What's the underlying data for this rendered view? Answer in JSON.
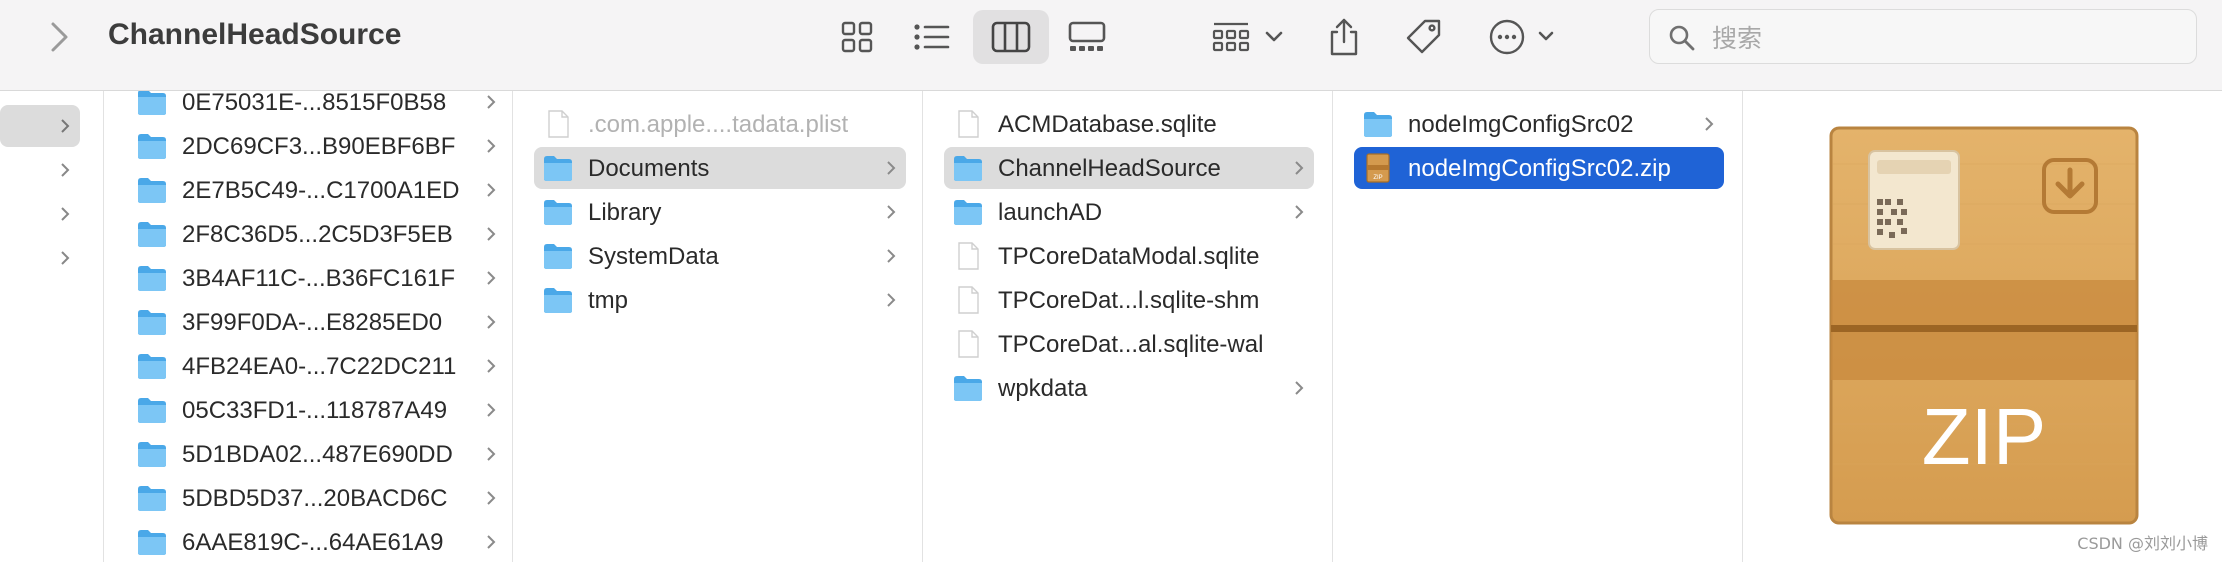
{
  "window": {
    "title": "ChannelHeadSource"
  },
  "search": {
    "placeholder": "搜索"
  },
  "toolbar": {
    "icons": [
      "chevron-right-icon",
      "icon-view-icon",
      "list-view-icon",
      "column-view-icon",
      "gallery-view-icon",
      "group-icon",
      "share-icon",
      "tag-icon",
      "more-icon",
      "search-icon"
    ],
    "active_view": "column"
  },
  "colors": {
    "selection_blue": "#1f63d6",
    "selection_gray": "#dcdcdc",
    "folder_blue": "#5eb8ee"
  },
  "column1": {
    "items": [
      {
        "label": "0E75031E-...8515F0B58"
      },
      {
        "label": "2DC69CF3...B90EBF6BF"
      },
      {
        "label": "2E7B5C49-...C1700A1ED"
      },
      {
        "label": "2F8C36D5...2C5D3F5EB"
      },
      {
        "label": "3B4AF11C-...B36FC161F"
      },
      {
        "label": "3F99F0DA-...E8285ED0"
      },
      {
        "label": "4FB24EA0-...7C22DC211"
      },
      {
        "label": "05C33FD1-...118787A49"
      },
      {
        "label": "5D1BDA02...487E690DD"
      },
      {
        "label": "5DBD5D37...20BACD6C"
      },
      {
        "label": "6AAE819C-...64AE61A9"
      }
    ]
  },
  "column2": {
    "items": [
      {
        "label": ".com.apple....tadata.plist",
        "type": "file",
        "dim": true
      },
      {
        "label": "Documents",
        "type": "folder",
        "selected": true
      },
      {
        "label": "Library",
        "type": "folder"
      },
      {
        "label": "SystemData",
        "type": "folder"
      },
      {
        "label": "tmp",
        "type": "folder"
      }
    ]
  },
  "column3": {
    "items": [
      {
        "label": "ACMDatabase.sqlite",
        "type": "file"
      },
      {
        "label": "ChannelHeadSource",
        "type": "folder",
        "selected": true
      },
      {
        "label": "launchAD",
        "type": "folder"
      },
      {
        "label": "TPCoreDataModal.sqlite",
        "type": "file"
      },
      {
        "label": "TPCoreDat...l.sqlite-shm",
        "type": "file"
      },
      {
        "label": "TPCoreDat...al.sqlite-wal",
        "type": "file"
      },
      {
        "label": "wpkdata",
        "type": "folder"
      }
    ]
  },
  "column4": {
    "items": [
      {
        "label": "nodeImgConfigSrc02",
        "type": "folder"
      },
      {
        "label": "nodeImgConfigSrc02.zip",
        "type": "zip",
        "selected": true
      }
    ]
  },
  "preview": {
    "badge": "ZIP",
    "file_icon_label": "zip"
  },
  "watermark": "CSDN @刘刘小博"
}
